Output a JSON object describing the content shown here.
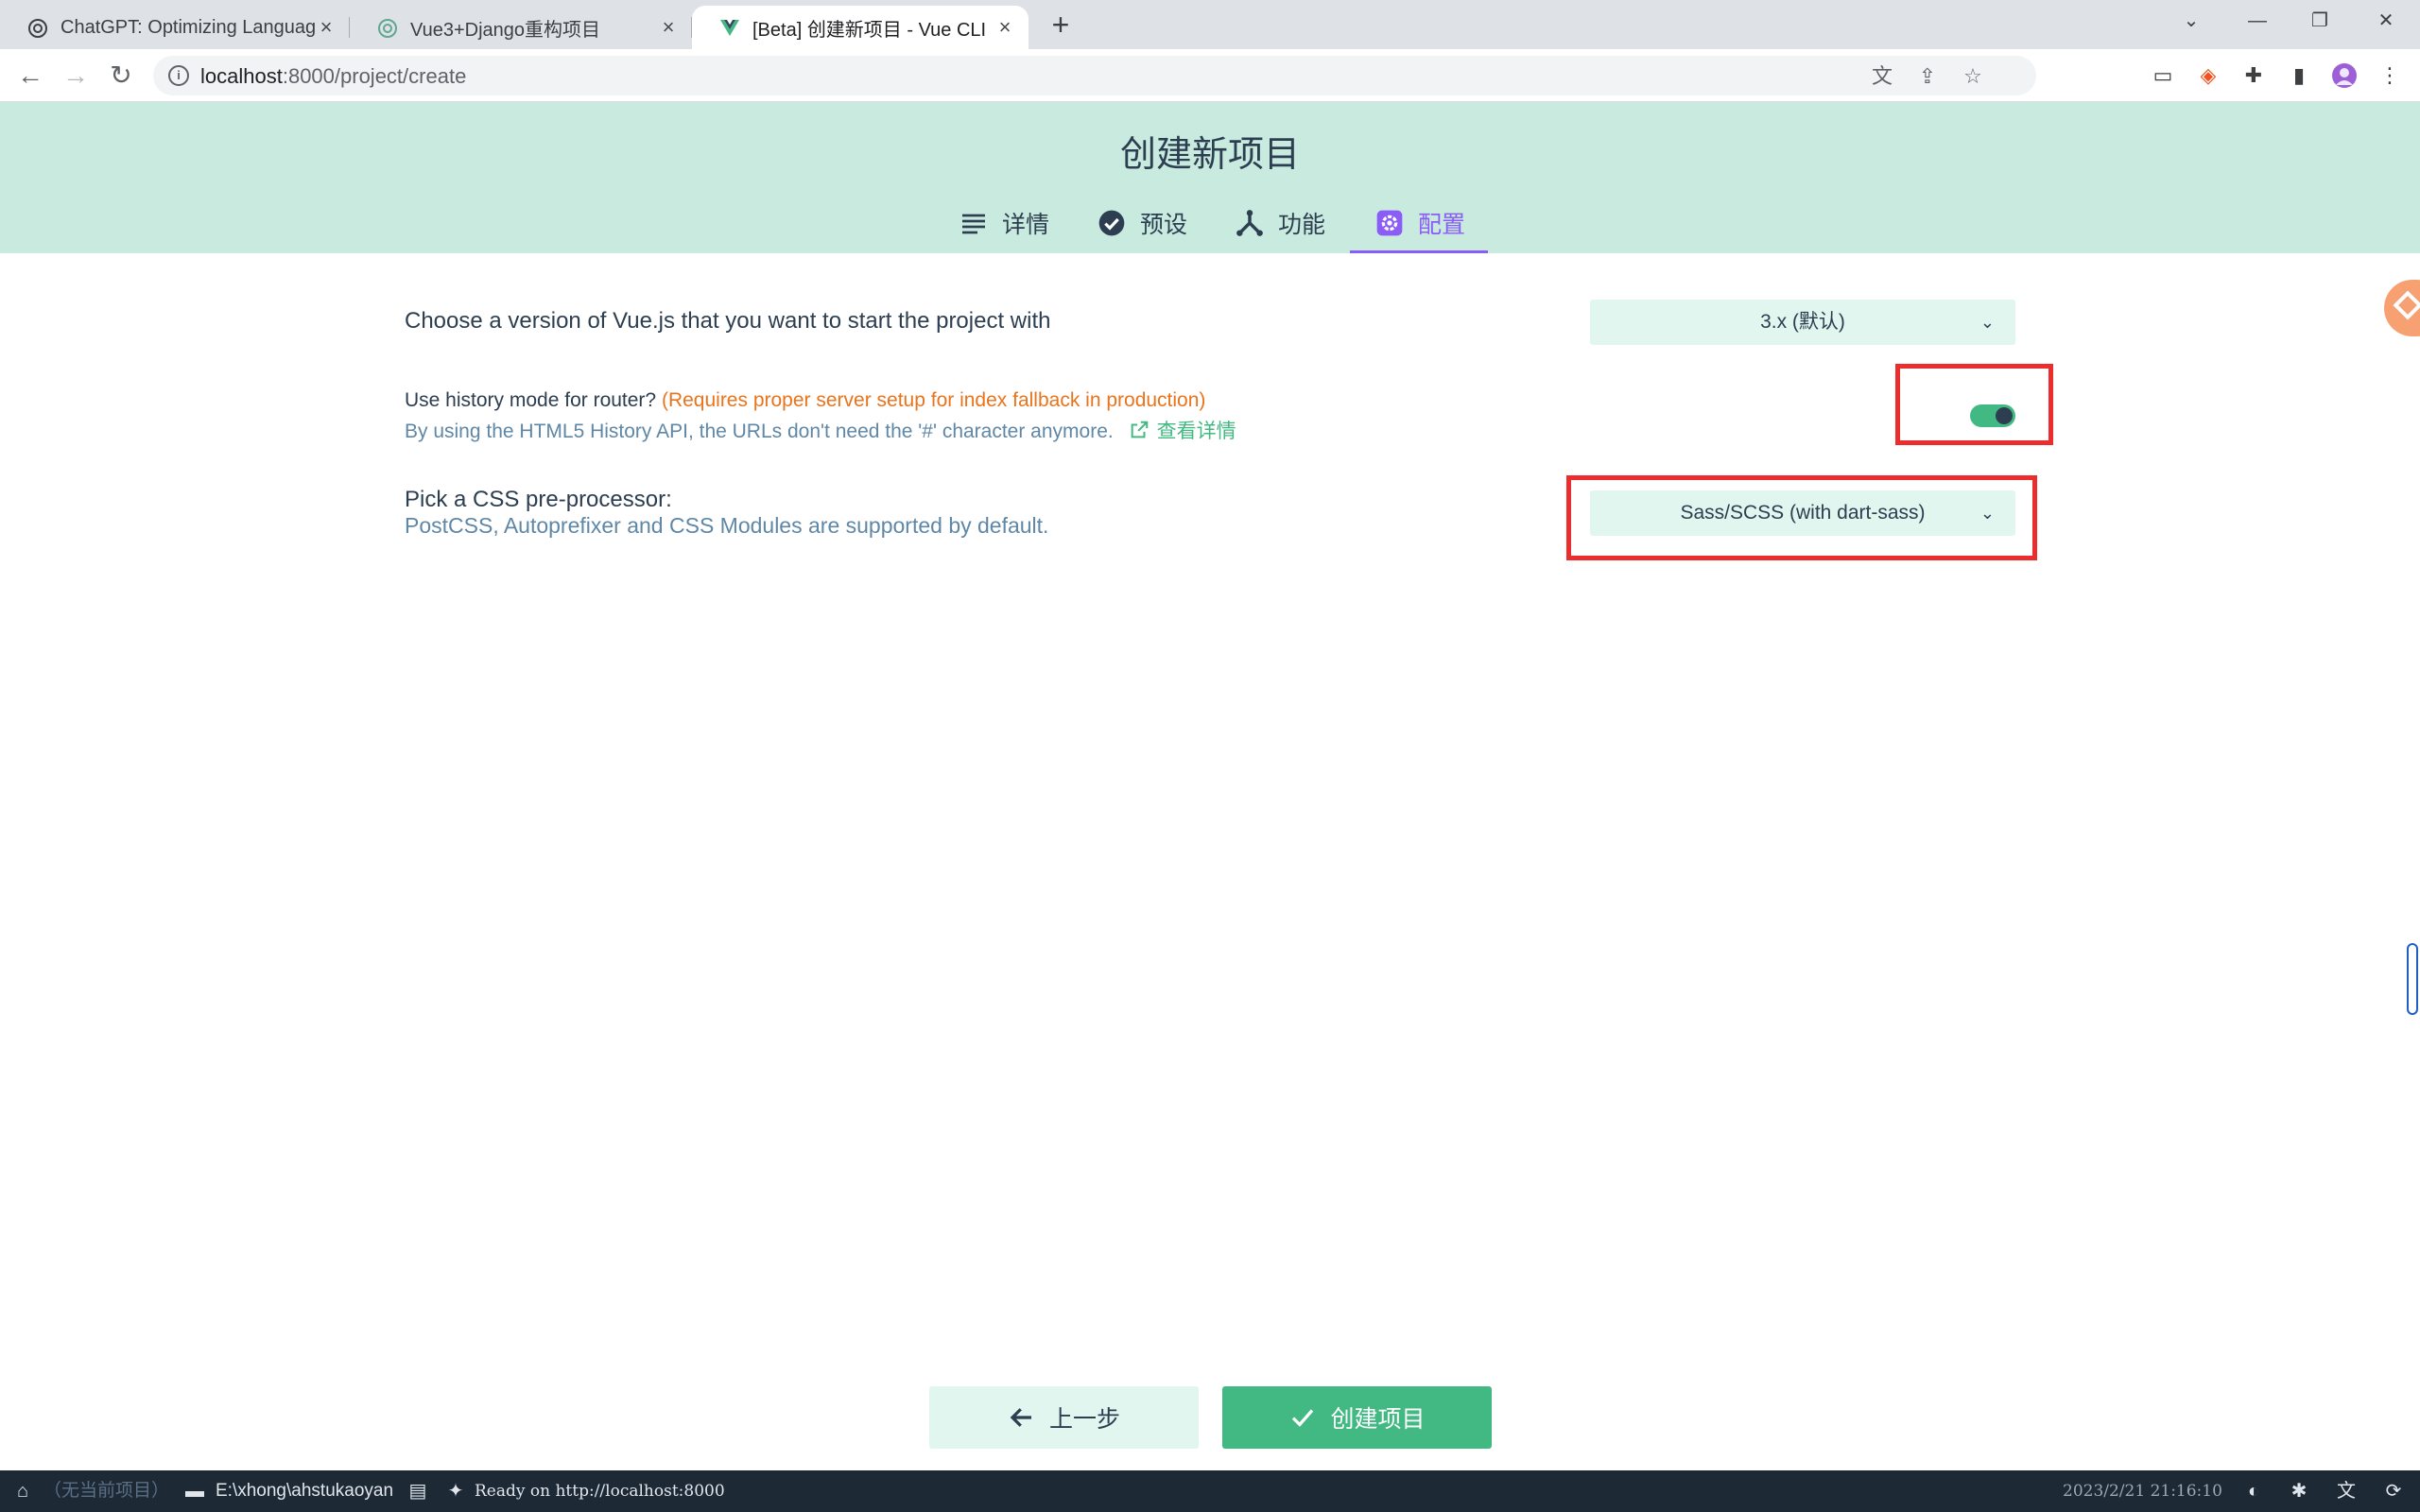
{
  "browser": {
    "tabs": [
      {
        "title": "ChatGPT: Optimizing Languag",
        "icon": "chatgpt-icon",
        "active": false
      },
      {
        "title": "Vue3+Django重构项目",
        "icon": "chatgpt-icon",
        "active": false
      },
      {
        "title": "[Beta] 创建新项目 - Vue CLI",
        "icon": "vue-icon",
        "active": true
      }
    ],
    "new_tab_label": "+",
    "url_host": "localhost",
    "url_path": ":8000/project/create"
  },
  "header": {
    "title": "创建新项目",
    "steps": [
      {
        "label": "详情",
        "icon": "list-icon",
        "active": false
      },
      {
        "label": "预设",
        "icon": "check-circle-icon",
        "active": false
      },
      {
        "label": "功能",
        "icon": "fork-icon",
        "active": false
      },
      {
        "label": "配置",
        "icon": "gear-icon",
        "active": true
      }
    ]
  },
  "config": {
    "vue_version": {
      "label": "Choose a version of Vue.js that you want to start the project with",
      "value": "3.x (默认)"
    },
    "history_mode": {
      "label": "Use history mode for router?",
      "warning": "(Requires proper server setup for index fallback in production)",
      "description": "By using the HTML5 History API, the URLs don't need the '#' character anymore.",
      "link_text": "查看详情",
      "enabled": true
    },
    "css_preprocessor": {
      "label": "Pick a CSS pre-processor:",
      "description": "PostCSS, Autoprefixer and CSS Modules are supported by default.",
      "value": "Sass/SCSS (with dart-sass)"
    }
  },
  "actions": {
    "prev_label": "上一步",
    "create_label": "创建项目"
  },
  "statusbar": {
    "project": "（无当前项目）",
    "folder": "E:\\xhong\\ahstukaoyan",
    "log": "Ready on http://localhost:8000",
    "datetime": "2023/2/21  21:16:10"
  },
  "colors": {
    "accent_green": "#42b983",
    "header_bg": "#c8eadf",
    "active_step": "#8b5cf6",
    "highlight_red": "#ec2d2d",
    "statusbar_bg": "#1d2935"
  }
}
